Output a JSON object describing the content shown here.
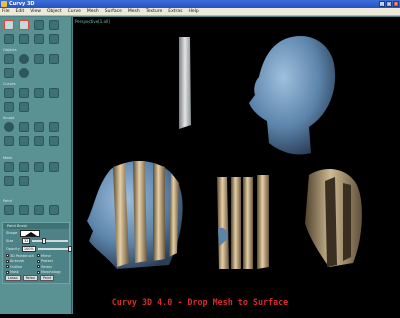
{
  "app": {
    "title": "Curvy 3D"
  },
  "menu": [
    "File",
    "Edit",
    "View",
    "Object",
    "Curve",
    "Mesh",
    "Surface",
    "Mesh",
    "Texture",
    "Extras",
    "Help"
  ],
  "toolbox": {
    "sections": [
      "Objects",
      "Curves",
      "Sculpt",
      "Mesh",
      "Paint"
    ]
  },
  "viewport": {
    "label": "Perspective[1.all]"
  },
  "panel": {
    "title": "Paint Brush",
    "shape_label": "Shape",
    "size_label": "Size",
    "size_value": "32",
    "opacity_label": "Opacity",
    "opacity_value": "100%",
    "options": [
      "3D Paintbrush",
      "Mirror",
      "Airbrush",
      "Protect",
      "Outline",
      "Smear",
      "Mask",
      "Morphology",
      "Grid"
    ],
    "buttons": [
      "Lasso",
      "Relax",
      "Paint"
    ]
  },
  "caption": "Curvy 3D 4.0 - Drop Mesh to Surface",
  "colors": {
    "accent": "#d82a2a",
    "titlebar": "#2453c4",
    "toolbox": "#5a9294"
  }
}
